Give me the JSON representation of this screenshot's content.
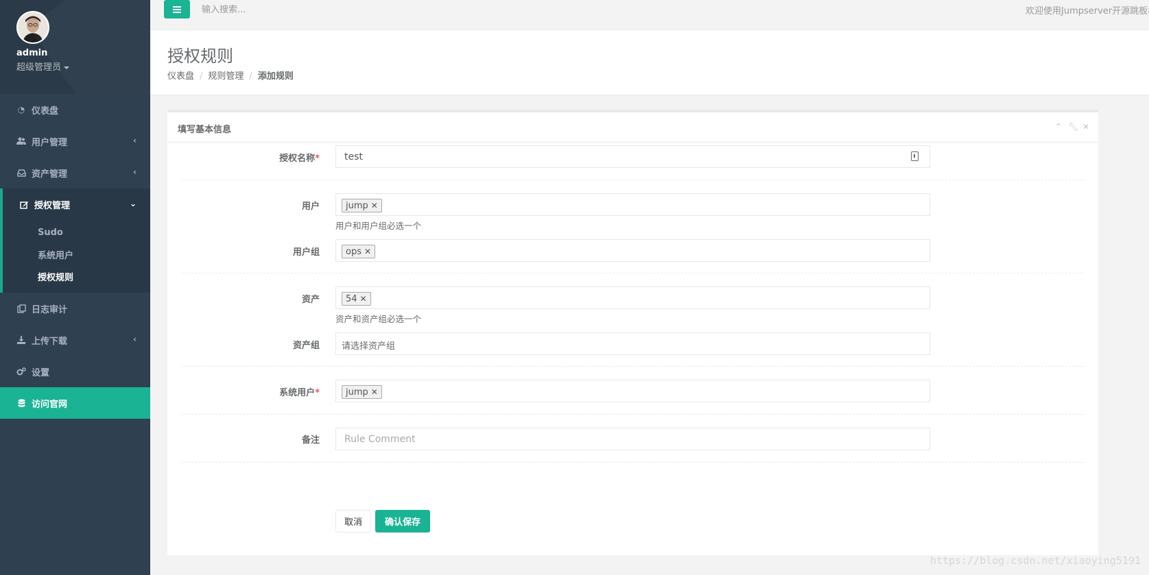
{
  "profile": {
    "name": "admin",
    "role": "超级管理员"
  },
  "sidebar": {
    "items": [
      {
        "label": "仪表盘",
        "icon": "dashboard-icon"
      },
      {
        "label": "用户管理",
        "icon": "users-icon"
      },
      {
        "label": "资产管理",
        "icon": "inbox-icon"
      },
      {
        "label": "授权管理",
        "icon": "edit-icon"
      },
      {
        "label": "日志审计",
        "icon": "copy-icon"
      },
      {
        "label": "上传下载",
        "icon": "download-icon"
      },
      {
        "label": "设置",
        "icon": "gears-icon"
      },
      {
        "label": "访问官网",
        "icon": "database-icon"
      }
    ],
    "submenu": [
      "Sudo",
      "系统用户",
      "授权规则"
    ]
  },
  "topbar": {
    "search_placeholder": "输入搜索...",
    "welcome": "欢迎使用Jumpserver开源跳板机"
  },
  "heading": {
    "title": "授权规则",
    "breadcrumb": [
      "仪表盘",
      "规则管理",
      "添加规则"
    ]
  },
  "panel": {
    "title": "填写基本信息"
  },
  "form": {
    "name_label": "授权名称",
    "name_value": "test",
    "user_label": "用户",
    "user_tag": "jump",
    "user_help": "用户和用户组必选一个",
    "usergroup_label": "用户组",
    "usergroup_tag": "ops",
    "asset_label": "资产",
    "asset_tag": "54",
    "asset_help": "资产和资产组必选一个",
    "assetgroup_label": "资产组",
    "assetgroup_placeholder": "请选择资产组",
    "sysuser_label": "系统用户",
    "sysuser_tag": "jump",
    "comment_label": "备注",
    "comment_placeholder": "Rule Comment",
    "cancel": "取消",
    "save": "确认保存",
    "required_mark": "*"
  },
  "watermark": "https://blog.csdn.net/xiaoying5191",
  "colors": {
    "accent": "#1ab394",
    "sidebar": "#2f4050",
    "required": "#ed5565"
  }
}
